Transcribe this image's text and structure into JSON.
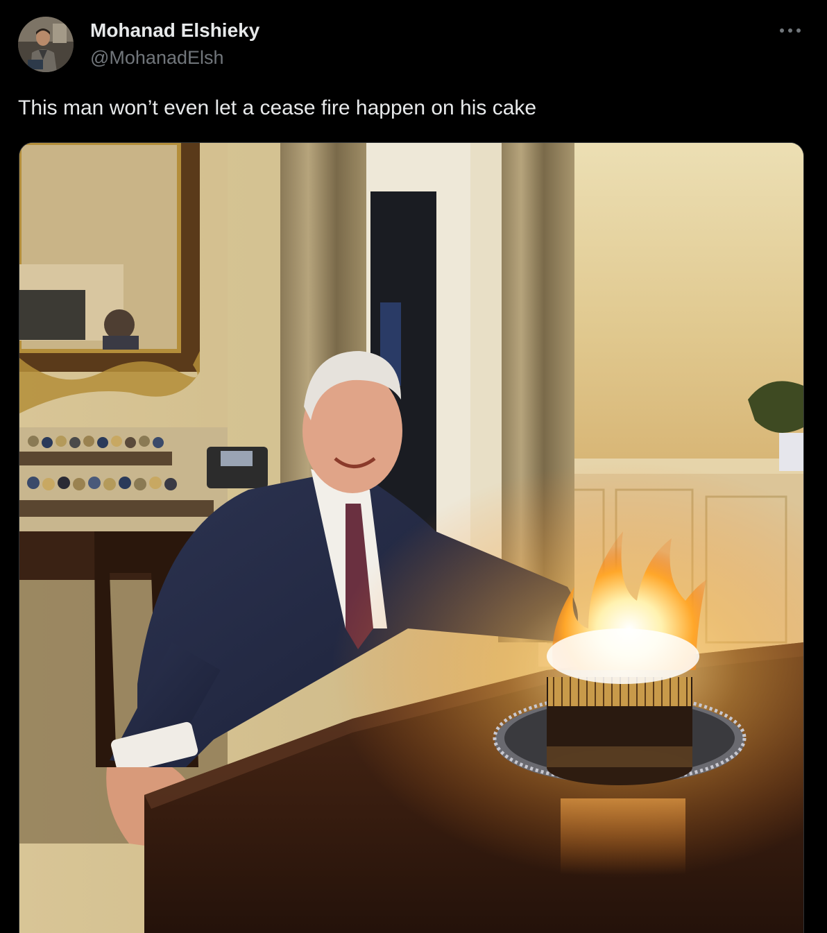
{
  "author": {
    "display_name": "Mohanad Elshieky",
    "handle": "@MohanadElsh",
    "avatar_icon": "user-avatar-photo"
  },
  "tweet": {
    "text": "This man won’t even let a cease fire happen on his cake",
    "more_icon": "ellipsis-icon"
  },
  "media": {
    "type": "photo"
  },
  "colors": {
    "background": "#000000",
    "primary_text": "#e7e9ea",
    "secondary_text": "#71767b",
    "border": "#2f3336"
  }
}
